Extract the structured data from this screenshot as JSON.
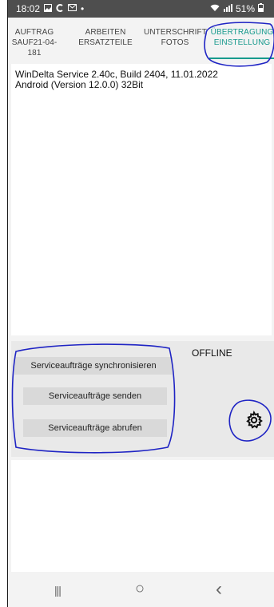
{
  "status_bar": {
    "time": "18:02",
    "notif_icons": [
      "image-icon",
      "c-icon",
      "mail-icon"
    ],
    "dot": "•",
    "battery": "51%"
  },
  "tabs": [
    {
      "line1": "AUFTRAG",
      "line2": "SAUF21-04-181",
      "active": false
    },
    {
      "line1": "ARBEITEN",
      "line2": "ERSATZTEILE",
      "active": false
    },
    {
      "line1": "UNTERSCHRIFT",
      "line2": "FOTOS",
      "active": false
    },
    {
      "line1": "ÜBERTRAGUNG",
      "line2": "EINSTELLUNG",
      "active": true
    }
  ],
  "info": {
    "version_line": "WinDelta Service 2.40c, Build 2404, 11.01.2022",
    "android_line": "Android (Version 12.0.0) 32Bit"
  },
  "actions": {
    "status": "OFFLINE",
    "sync_label": "Serviceaufträge synchronisieren",
    "send_label": "Serviceaufträge senden",
    "fetch_label": "Serviceaufträge abrufen",
    "settings_icon": "gear-icon"
  },
  "nav": {
    "recents": "|||",
    "home": "○",
    "back": "‹"
  },
  "colors": {
    "accent": "#179a8d",
    "annotation": "#1f24c4",
    "statusbar": "#4e4e4e"
  }
}
